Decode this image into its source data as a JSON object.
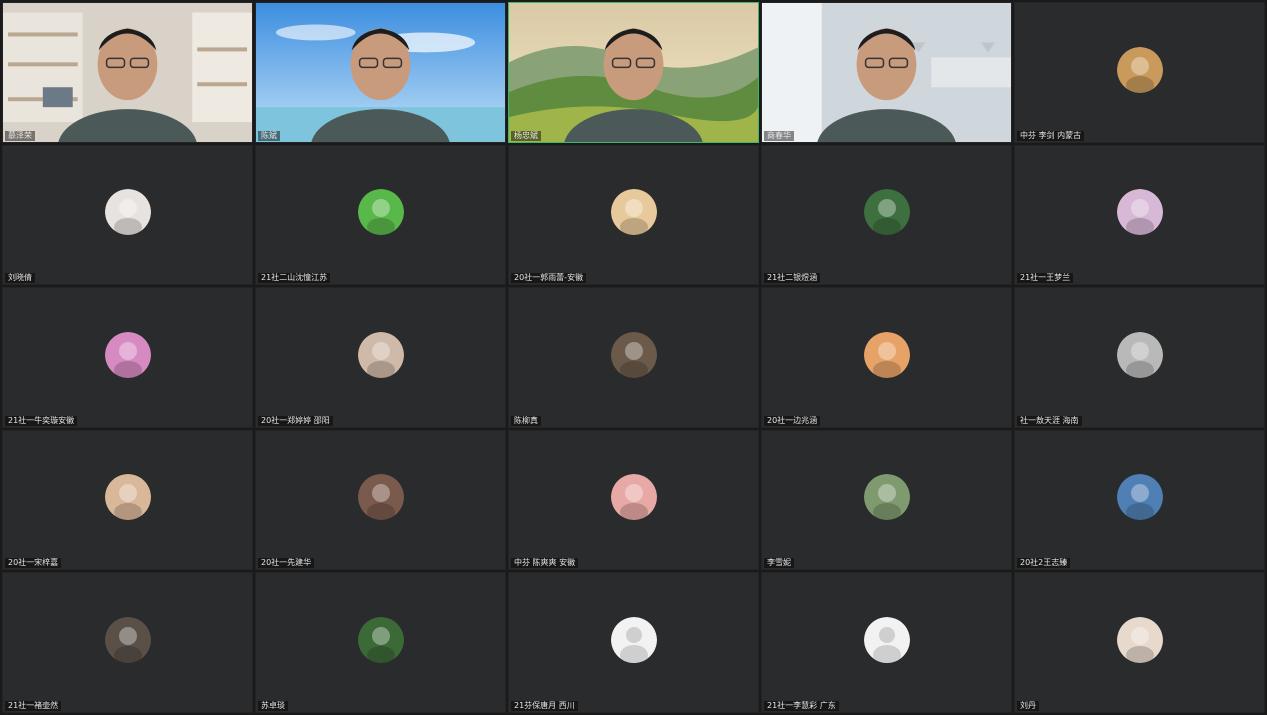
{
  "participants": [
    {
      "name": "慕泽荣",
      "type": "video",
      "scene": "office"
    },
    {
      "name": "陈斌",
      "type": "video",
      "scene": "sea"
    },
    {
      "name": "杨忠斌",
      "type": "video",
      "scene": "hills",
      "active": true
    },
    {
      "name": "商春华",
      "type": "video",
      "scene": "room"
    },
    {
      "name": "中芬 李剑 内蒙古",
      "type": "avatar",
      "icon": "meerkat-avatar-icon",
      "color": "#c99a5b"
    },
    {
      "name": "刘晓倩",
      "type": "avatar",
      "icon": "cartoon-girl-avatar-icon",
      "color": "#e9e3df"
    },
    {
      "name": "21社二山沈憧江苏",
      "type": "avatar",
      "icon": "green-alien-avatar-icon",
      "color": "#59b84a"
    },
    {
      "name": "20社一郭雨蕾-安徽",
      "type": "avatar",
      "icon": "anime-blonde-avatar-icon",
      "color": "#e8c99c"
    },
    {
      "name": "21社二银煜涵",
      "type": "avatar",
      "icon": "forest-avatar-icon",
      "color": "#3d6f3f"
    },
    {
      "name": "21社一王梦兰",
      "type": "avatar",
      "icon": "painted-lady-avatar-icon",
      "color": "#d7b8d6"
    },
    {
      "name": "21社一牛奕璇安徽",
      "type": "avatar",
      "icon": "pink-monster-avatar-icon",
      "color": "#d78ac2"
    },
    {
      "name": "20社一郑婷婷 邵阳",
      "type": "avatar",
      "icon": "woman-photo-avatar-icon",
      "color": "#cfb9a8"
    },
    {
      "name": "陈柳真",
      "type": "avatar",
      "icon": "city-night-avatar-icon",
      "color": "#6b5a4a"
    },
    {
      "name": "20社一边兆涵",
      "type": "avatar",
      "icon": "anime-girl-avatar-icon",
      "color": "#e7a268"
    },
    {
      "name": "社一敖天涯 海南",
      "type": "avatar",
      "icon": "rat-avatar-icon",
      "color": "#b9b9b9"
    },
    {
      "name": "20社一宋梓嘉",
      "type": "avatar",
      "icon": "teddy-bear-avatar-icon",
      "color": "#d9b89a"
    },
    {
      "name": "20社一先建华",
      "type": "avatar",
      "icon": "man-photo-avatar-icon",
      "color": "#7a5a4c"
    },
    {
      "name": "中芬 陈爽爽 安徽",
      "type": "avatar",
      "icon": "pink-sky-avatar-icon",
      "color": "#e7a9a5"
    },
    {
      "name": "李雪妮",
      "type": "avatar",
      "icon": "standing-person-avatar-icon",
      "color": "#7f9a6e"
    },
    {
      "name": "20社2王志臻",
      "type": "avatar",
      "icon": "blue-dress-avatar-icon",
      "color": "#4f7fb4"
    },
    {
      "name": "21社一褚壶然",
      "type": "avatar",
      "icon": "group-photo-avatar-icon",
      "color": "#5a5048"
    },
    {
      "name": "苏卓琰",
      "type": "avatar",
      "icon": "toucan-avatar-icon",
      "color": "#3c6a37"
    },
    {
      "name": "21芬保唐月 西川",
      "type": "avatar",
      "icon": "default-user-avatar-icon",
      "color": "#d5d5d5"
    },
    {
      "name": "21社一李慧彩 广东",
      "type": "avatar",
      "icon": "default-user-avatar-icon",
      "color": "#d5d5d5"
    },
    {
      "name": "刘丹",
      "type": "avatar",
      "icon": "costume-woman-avatar-icon",
      "color": "#e7d9cc"
    }
  ]
}
